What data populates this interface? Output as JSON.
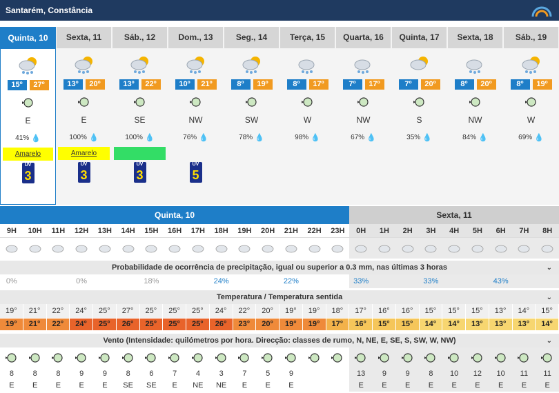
{
  "header": {
    "title": "Santarém, Constância"
  },
  "days": [
    {
      "name": "Quinta, 10",
      "icon": "cloud-sun-rain-icon",
      "tmin": "15º",
      "tmax": "27º",
      "dir": "E",
      "prec": "41%",
      "warn": "Amarelo",
      "warn_color": "yellow",
      "uv": "3"
    },
    {
      "name": "Sexta, 11",
      "icon": "cloud-sun-rain-icon",
      "tmin": "13º",
      "tmax": "20º",
      "dir": "E",
      "prec": "100%",
      "warn": "Amarelo",
      "warn_color": "yellow",
      "uv": "3"
    },
    {
      "name": "Sáb., 12",
      "icon": "cloud-sun-rain-icon",
      "tmin": "13º",
      "tmax": "22º",
      "dir": "SE",
      "prec": "100%",
      "warn": "",
      "warn_color": "green",
      "uv": "3"
    },
    {
      "name": "Dom., 13",
      "icon": "cloud-sun-rain-icon",
      "tmin": "10º",
      "tmax": "21º",
      "dir": "NW",
      "prec": "76%",
      "warn": "",
      "warn_color": "none",
      "uv": "5"
    },
    {
      "name": "Seg., 14",
      "icon": "cloud-sun-rain-icon",
      "tmin": "8º",
      "tmax": "19º",
      "dir": "SW",
      "prec": "78%",
      "warn": "",
      "warn_color": "none",
      "uv": ""
    },
    {
      "name": "Terça, 15",
      "icon": "cloud-rain-icon",
      "tmin": "8º",
      "tmax": "17º",
      "dir": "W",
      "prec": "98%",
      "warn": "",
      "warn_color": "none",
      "uv": ""
    },
    {
      "name": "Quarta, 16",
      "icon": "cloud-rain-icon",
      "tmin": "7º",
      "tmax": "17º",
      "dir": "NW",
      "prec": "67%",
      "warn": "",
      "warn_color": "none",
      "uv": ""
    },
    {
      "name": "Quinta, 17",
      "icon": "sun-cloud-icon",
      "tmin": "7º",
      "tmax": "20º",
      "dir": "S",
      "prec": "35%",
      "warn": "",
      "warn_color": "none",
      "uv": ""
    },
    {
      "name": "Sexta, 18",
      "icon": "cloud-rain-icon",
      "tmin": "8º",
      "tmax": "20º",
      "dir": "NW",
      "prec": "84%",
      "warn": "",
      "warn_color": "none",
      "uv": ""
    },
    {
      "name": "Sáb., 19",
      "icon": "cloud-sun-rain-icon",
      "tmin": "8º",
      "tmax": "19º",
      "dir": "W",
      "prec": "69%",
      "warn": "",
      "warn_color": "none",
      "uv": ""
    }
  ],
  "hourly": {
    "day1": "Quinta, 10",
    "day2": "Sexta, 11",
    "hours": [
      "9H",
      "10H",
      "11H",
      "12H",
      "13H",
      "14H",
      "15H",
      "16H",
      "17H",
      "18H",
      "19H",
      "20H",
      "21H",
      "22H",
      "23H",
      "0H",
      "1H",
      "2H",
      "3H",
      "4H",
      "5H",
      "6H",
      "7H",
      "8H"
    ],
    "night_from": 15,
    "prob_title": "Probabilidade de ocorrência de precipitação, igual ou superior a 0.3 mm, nas últimas 3 horas",
    "prob": [
      "0%",
      "",
      "",
      "0%",
      "",
      "",
      "18%",
      "",
      "",
      "24%",
      "",
      "",
      "22%",
      "",
      "",
      "33%",
      "",
      "",
      "33%",
      "",
      "",
      "43%",
      "",
      ""
    ],
    "temp_title": "Temperatura / Temperatura sentida",
    "temp": [
      "19°",
      "21°",
      "22°",
      "24°",
      "25°",
      "27°",
      "25°",
      "25°",
      "25°",
      "24°",
      "22°",
      "20°",
      "19°",
      "19°",
      "18°",
      "17°",
      "16°",
      "16°",
      "15°",
      "15°",
      "15°",
      "13°",
      "14°",
      "15°"
    ],
    "feel": [
      "19°",
      "21°",
      "22°",
      "24°",
      "25°",
      "26°",
      "25°",
      "25°",
      "25°",
      "26°",
      "23°",
      "20°",
      "19°",
      "19°",
      "17°",
      "16°",
      "15°",
      "15°",
      "14°",
      "14°",
      "13°",
      "13°",
      "13°",
      "14°"
    ],
    "feel_colors": [
      "#ef8a3a",
      "#ef8a3a",
      "#ef8a3a",
      "#e8632a",
      "#e8632a",
      "#e8632a",
      "#e8632a",
      "#e8632a",
      "#e8632a",
      "#e8632a",
      "#ef8a3a",
      "#ef8a3a",
      "#ef8a3a",
      "#ef8a3a",
      "#f3b24a",
      "#f5c65a",
      "#f5c65a",
      "#f5c65a",
      "#f7d670",
      "#f7d670",
      "#f7d670",
      "#f7d670",
      "#f7d670",
      "#f7d670"
    ],
    "wind_title": "Vento (Intensidade: quilómetros por hora. Direcção: classes de rumo, N, NE, E, SE, S, SW, W, NW)",
    "wspd": [
      "8",
      "8",
      "8",
      "9",
      "9",
      "8",
      "6",
      "7",
      "4",
      "3",
      "7",
      "5",
      "9",
      "",
      "",
      "13",
      "9",
      "9",
      "8",
      "10",
      "12",
      "10",
      "11",
      "11"
    ],
    "wdir": [
      "E",
      "E",
      "E",
      "E",
      "E",
      "SE",
      "SE",
      "E",
      "NE",
      "NE",
      "E",
      "E",
      "E",
      "",
      "",
      "E",
      "E",
      "E",
      "E",
      "E",
      "E",
      "E",
      "E",
      "E"
    ]
  }
}
